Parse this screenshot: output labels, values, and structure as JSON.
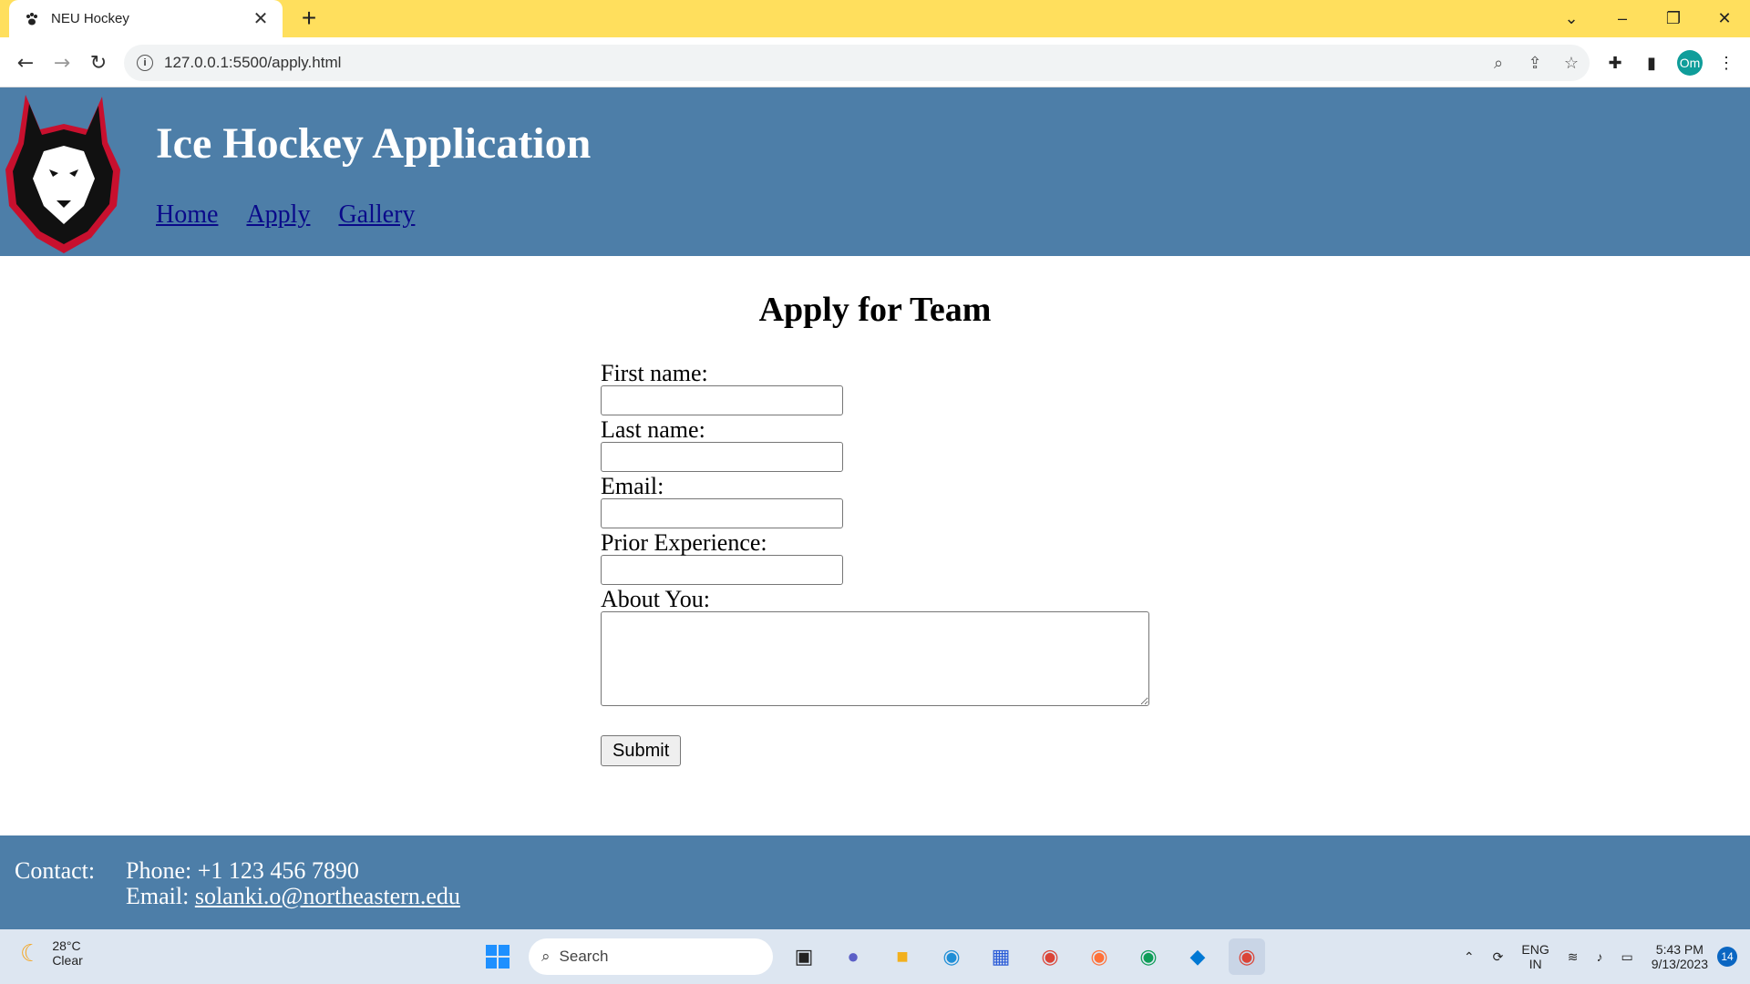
{
  "browser": {
    "tab_title": "NEU Hockey",
    "tab_close": "✕",
    "new_tab": "+",
    "url": "127.0.0.1:5500/apply.html",
    "profile_initials": "Om",
    "window_controls": [
      "⌄",
      "–",
      "❐",
      "✕"
    ]
  },
  "site": {
    "title": "Ice Hockey Application",
    "nav": [
      {
        "label": "Home"
      },
      {
        "label": "Apply"
      },
      {
        "label": "Gallery"
      }
    ]
  },
  "main": {
    "heading": "Apply for Team",
    "fields": {
      "first_name_label": "First name:",
      "first_name_value": "",
      "last_name_label": "Last name:",
      "last_name_value": "",
      "email_label": "Email:",
      "email_value": "",
      "experience_label": "Prior Experience:",
      "experience_value": "",
      "about_label": "About You:",
      "about_value": ""
    },
    "submit_label": "Submit"
  },
  "footer": {
    "contact_label": "Contact:",
    "phone": "Phone: +1 123 456 7890",
    "email_prefix": "Email:",
    "email": "solanki.o@northeastern.edu"
  },
  "taskbar": {
    "temperature": "28°C",
    "condition": "Clear",
    "search_placeholder": "Search",
    "lang_top": "ENG",
    "lang_bottom": "IN",
    "time": "5:43 PM",
    "date": "9/13/2023",
    "notifications": "14"
  },
  "colors": {
    "tab_strip": "#ffdf5d",
    "header_bg": "#4d7ea8",
    "nav_link": "#0a0a8a"
  }
}
